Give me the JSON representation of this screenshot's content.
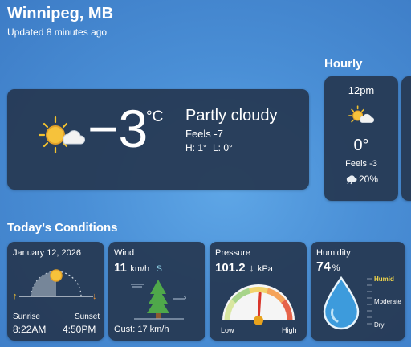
{
  "location": {
    "city": "Winnipeg, MB",
    "updated": "Updated 8 minutes ago"
  },
  "current": {
    "temp": "−3",
    "unit": "°C",
    "condition": "Partly cloudy",
    "feels": "Feels -7",
    "high": "H: 1°",
    "low": "L: 0°",
    "icon": "partly-cloudy-icon"
  },
  "hourly": {
    "title": "Hourly",
    "items": [
      {
        "time": "12pm",
        "icon": "partly-cloudy-icon",
        "temp": "0°",
        "feels": "Feels -3",
        "precip": "20%",
        "precip_icon": "rain-cloud-icon"
      }
    ]
  },
  "conditions": {
    "title": "Today’s Conditions",
    "sun": {
      "date": "January 12, 2026",
      "sunrise_label": "Sunrise",
      "sunrise": "8:22AM",
      "sunset_label": "Sunset",
      "sunset": "4:50PM"
    },
    "wind": {
      "label": "Wind",
      "speed": "11",
      "unit": "km/h",
      "dir": "S",
      "gust": "Gust: 17 km/h"
    },
    "pressure": {
      "label": "Pressure",
      "value": "101.2",
      "arrow": "↓",
      "unit": "kPa",
      "low": "Low",
      "high": "High",
      "level": 0.52
    },
    "humidity": {
      "label": "Humidity",
      "value": "74",
      "unit": "%",
      "scale_top": "Humid",
      "scale_mid": "Moderate",
      "scale_bot": "Dry",
      "level": 0.74
    }
  },
  "colors": {
    "accent": "#f2c230",
    "card": "#263852",
    "humid": "#f6d94a"
  }
}
